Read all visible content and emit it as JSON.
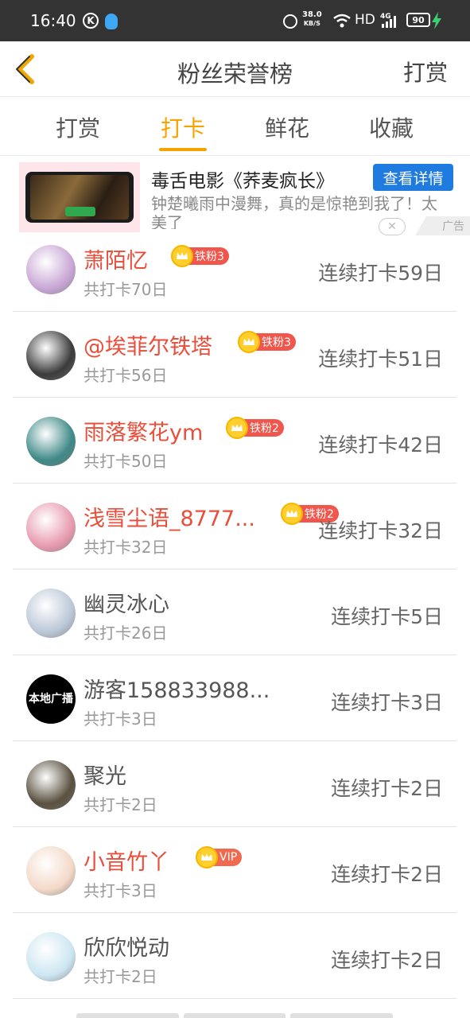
{
  "status_bar": {
    "time": "16:40",
    "k_icon": "K",
    "speed_value": "38.0",
    "speed_unit": "KB/S",
    "network": "HD",
    "signal": "4G",
    "battery": "90"
  },
  "header": {
    "title": "粉丝荣誉榜",
    "reward_link": "打赏"
  },
  "tabs": [
    {
      "label": "打赏",
      "active": false
    },
    {
      "label": "打卡",
      "active": true
    },
    {
      "label": "鲜花",
      "active": false
    },
    {
      "label": "收藏",
      "active": false
    }
  ],
  "ad": {
    "title": "毒舌电影《荞麦疯长》",
    "description": "钟楚曦雨中漫舞，真的是惊艳到我了！太美了",
    "detail_button": "查看详情",
    "badge": "广告",
    "close_symbol": "✕"
  },
  "fans": [
    {
      "name": "萧陌忆",
      "highlight": true,
      "badge_icon": "crown-icon",
      "badge": "铁粉3",
      "total": "共打卡70日",
      "streak": "连续打卡59日",
      "avatar_color": "#c9a7d6"
    },
    {
      "name": "@埃菲尔铁塔",
      "highlight": true,
      "badge_icon": "crown-icon",
      "badge": "铁粉3",
      "total": "共打卡56日",
      "streak": "连续打卡51日",
      "avatar_color": "#3b3b3b"
    },
    {
      "name": "雨落繁花ym",
      "highlight": true,
      "badge_icon": "crown-icon",
      "badge": "铁粉2",
      "total": "共打卡50日",
      "streak": "连续打卡42日",
      "avatar_color": "#3f8a88"
    },
    {
      "name": "浅雪尘语_8777...",
      "highlight": true,
      "badge_icon": "crown-icon",
      "badge": "铁粉2",
      "total": "共打卡32日",
      "streak": "连续打卡32日",
      "avatar_color": "#e89bb0"
    },
    {
      "name": "幽灵冰心",
      "highlight": false,
      "badge_icon": "",
      "badge": "",
      "total": "共打卡26日",
      "streak": "连续打卡5日",
      "avatar_color": "#bcc8d8"
    },
    {
      "name": "游客158833988...",
      "highlight": false,
      "badge_icon": "",
      "badge": "",
      "total": "共打卡3日",
      "streak": "连续打卡3日",
      "avatar_color": "#000000",
      "avatar_text": "本地广播"
    },
    {
      "name": "聚光",
      "highlight": false,
      "badge_icon": "",
      "badge": "",
      "total": "共打卡2日",
      "streak": "连续打卡2日",
      "avatar_color": "#5a5040"
    },
    {
      "name": "小音竹丫",
      "highlight": true,
      "badge_icon": "crown-icon",
      "badge": "VIP",
      "total": "共打卡3日",
      "streak": "连续打卡2日",
      "avatar_color": "#f3d9c8"
    },
    {
      "name": "欣欣悦动",
      "highlight": false,
      "badge_icon": "",
      "badge": "",
      "total": "共打卡2日",
      "streak": "连续打卡2日",
      "avatar_color": "#cde6f2"
    }
  ]
}
